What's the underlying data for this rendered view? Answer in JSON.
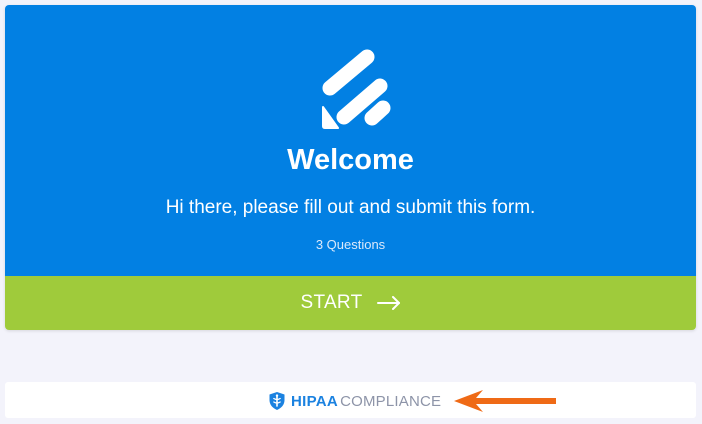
{
  "colors": {
    "page_background": "#f3f3fb",
    "header_blue": "#0280e3",
    "start_green": "#9fcb3b",
    "hipaa_blue": "#1b82e0",
    "compliance_gray": "#8d94a8",
    "annotation_arrow": "#ef6a16"
  },
  "welcome": {
    "logo_icon": "form-logo-icon",
    "title": "Welcome",
    "subtitle": "Hi there, please fill out and submit this form.",
    "questions_count": "3 Questions"
  },
  "start_button": {
    "label": "START",
    "icon": "arrow-right-icon"
  },
  "footer": {
    "badge_icon": "shield-medical-icon",
    "hipaa_label": "HIPAA",
    "compliance_label": "COMPLIANCE",
    "annotation_icon": "arrow-left-icon"
  }
}
